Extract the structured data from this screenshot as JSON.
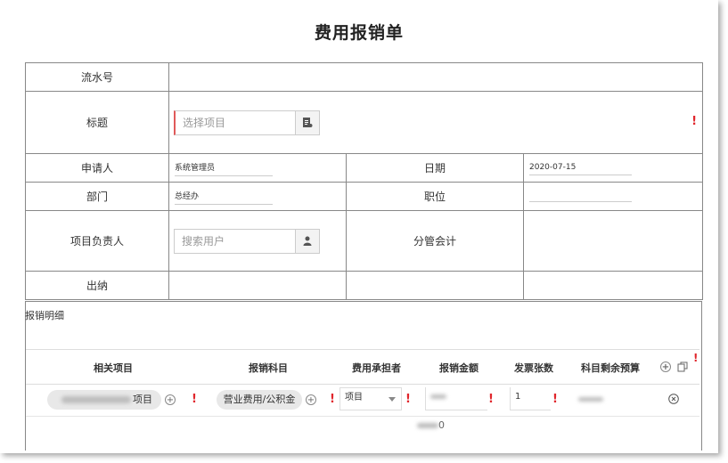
{
  "form": {
    "title": "费用报销单",
    "serial_label": "流水号",
    "serial_value": "",
    "subject_label": "标题",
    "subject_placeholder": "选择项目",
    "applicant_label": "申请人",
    "applicant_value": "系统管理员",
    "date_label": "日期",
    "date_value": "2020-07-15",
    "dept_label": "部门",
    "dept_value": "总经办",
    "position_label": "职位",
    "position_value": "",
    "project_owner_label": "项目负责人",
    "project_owner_placeholder": "搜索用户",
    "accountant_label": "分管会计",
    "accountant_value": "",
    "cashier_label": "出纳",
    "required_mark": "!"
  },
  "details": {
    "section_label": "报销明细",
    "columns": [
      "相关项目",
      "报销科目",
      "费用承担者",
      "报销金额",
      "发票张数",
      "科目剩余预算"
    ],
    "row": {
      "project_suffix": "项目",
      "subject": "营业费用/公积金",
      "bearer": "项目",
      "invoice_count": "1",
      "amount_suffix": "0"
    }
  },
  "icons": {
    "subject_button": "document-icon",
    "owner_button": "user-icon",
    "add": "plus-circle-icon",
    "copy": "copy-icon",
    "remove": "close-circle-icon",
    "dropdown": "caret-down-icon"
  },
  "colors": {
    "required": "#e0262c",
    "border": "#888888",
    "pill": "#e8e8e8"
  }
}
